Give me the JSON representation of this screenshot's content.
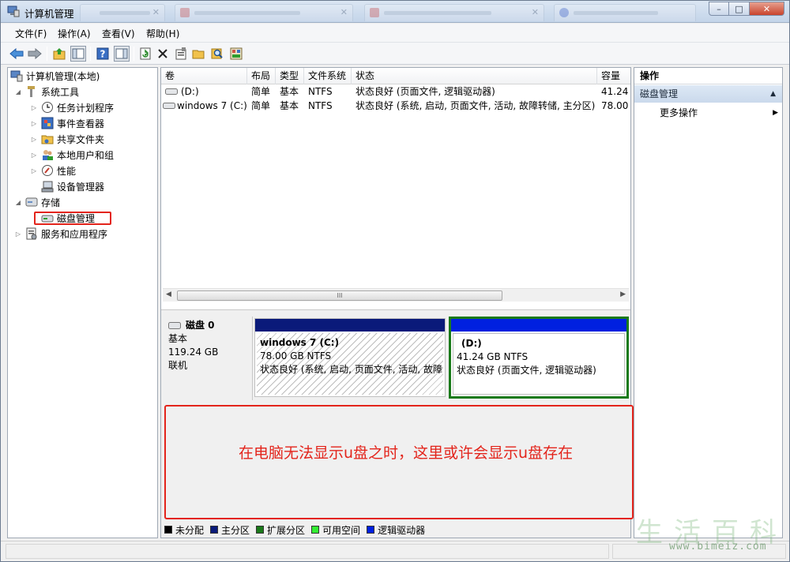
{
  "window": {
    "title": "计算机管理",
    "buttons": {
      "minimize": "–",
      "maximize": "□",
      "close": "✕"
    }
  },
  "menu": [
    "文件(F)",
    "操作(A)",
    "查看(V)",
    "帮助(H)"
  ],
  "toolbar": {
    "icons": [
      "back-icon",
      "forward-icon",
      "up-icon",
      "show-hide-tree-icon",
      "help-icon",
      "show-hide-action-pane-icon",
      "refresh-icon",
      "delete-icon",
      "properties-icon",
      "open-icon",
      "search-icon",
      "disk-settings-icon"
    ]
  },
  "nav": {
    "root": "计算机管理(本地)",
    "system_tools": "系统工具",
    "task_scheduler": "任务计划程序",
    "event_viewer": "事件查看器",
    "shared_folders": "共享文件夹",
    "local_users": "本地用户和组",
    "performance": "性能",
    "device_manager": "设备管理器",
    "storage": "存储",
    "disk_management": "磁盘管理",
    "services_apps": "服务和应用程序"
  },
  "volumes": {
    "columns": [
      "卷",
      "布局",
      "类型",
      "文件系统",
      "状态",
      "容量"
    ],
    "rows": [
      {
        "volume": "(D:)",
        "layout": "简单",
        "type": "基本",
        "fs": "NTFS",
        "status": "状态良好 (页面文件, 逻辑驱动器)",
        "capacity": "41.24 ("
      },
      {
        "volume": "windows 7 (C:)",
        "layout": "简单",
        "type": "基本",
        "fs": "NTFS",
        "status": "状态良好 (系统, 启动, 页面文件, 活动, 故障转储, 主分区)",
        "capacity": "78.00 ("
      }
    ],
    "scroll_grip": "III"
  },
  "disk": {
    "name": "磁盘 0",
    "kind": "基本",
    "size": "119.24 GB",
    "state": "联机",
    "partitions": [
      {
        "name": "windows 7  (C:)",
        "size": "78.00 GB NTFS",
        "status": "状态良好 (系统, 启动, 页面文件, 活动, 故障"
      },
      {
        "name": "(D:)",
        "size": "41.24 GB NTFS",
        "status": "状态良好 (页面文件, 逻辑驱动器)"
      }
    ]
  },
  "annotation": "在电脑无法显示u盘之时，这里或许会显示u盘存在",
  "legend": [
    {
      "label": "未分配",
      "color": "#000000"
    },
    {
      "label": "主分区",
      "color": "#0a1a7a"
    },
    {
      "label": "扩展分区",
      "color": "#1a7a1a"
    },
    {
      "label": "可用空间",
      "color": "#33ee33"
    },
    {
      "label": "逻辑驱动器",
      "color": "#0020e0"
    }
  ],
  "actions": {
    "header": "操作",
    "section": "磁盘管理",
    "more": "更多操作"
  },
  "watermark": {
    "title": "生活百科",
    "url": "www.bimeiz.com"
  }
}
